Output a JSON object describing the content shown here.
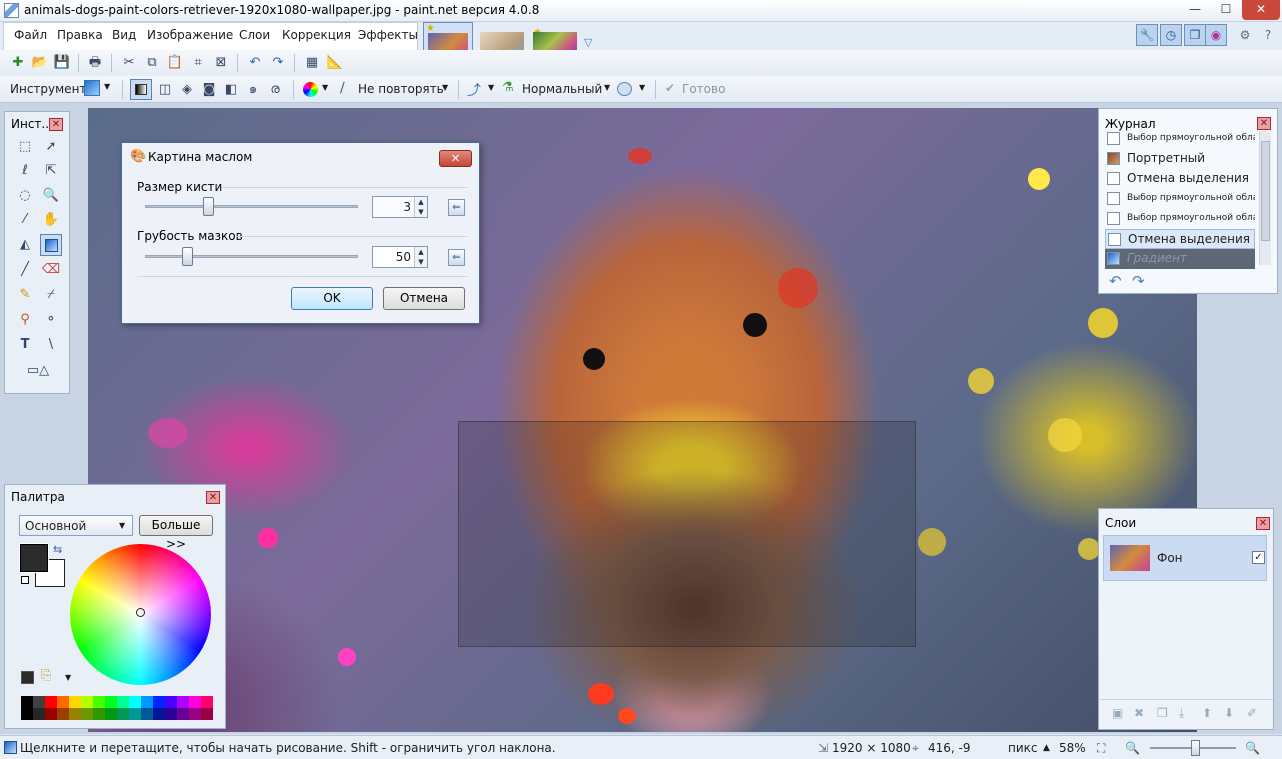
{
  "window": {
    "title": "animals-dogs-paint-colors-retriever-1920x1080-wallpaper.jpg - paint.net версия 4.0.8",
    "minimize": "—",
    "maximize": "☐",
    "close": "✕"
  },
  "menu": {
    "items": [
      "Файл",
      "Правка",
      "Вид",
      "Изображение",
      "Слои",
      "Коррекция",
      "Эффекты"
    ]
  },
  "toolbar2": {
    "tool_label": "Инструмент:",
    "repeat_mode": "Не повторять",
    "blend_mode": "Нормальный",
    "done_label": "Готово"
  },
  "tools_panel": {
    "title": "Инст...",
    "icons": [
      "rect-select-icon",
      "move-selection-icon",
      "lasso-icon",
      "move-selected-icon",
      "ellipse-select-icon",
      "zoom-icon",
      "magic-wand-icon",
      "pan-icon",
      "paint-bucket-icon",
      "gradient-icon",
      "paintbrush-icon",
      "eraser-icon",
      "pencil-icon",
      "color-picker-icon",
      "clone-stamp-icon",
      "recolor-icon",
      "text-icon",
      "line-curve-icon",
      "shapes-icon"
    ]
  },
  "dialog": {
    "title": "Картина маслом",
    "brush_size_label": "Размер кисти",
    "brush_size_value": "3",
    "brush_size_level": 0.3,
    "roughness_label": "Грубость мазков",
    "roughness_value": "50",
    "roughness_level": 0.2,
    "ok": "OK",
    "cancel": "Отмена"
  },
  "palette": {
    "title": "Палитра",
    "mode": "Основной",
    "more": "Больше >>",
    "primary_color": "#2b2b2b",
    "secondary_color": "#ffffff",
    "swatches": [
      "#000000",
      "#404040",
      "#ff0000",
      "#ff6a00",
      "#ffd800",
      "#b6ff00",
      "#4cff00",
      "#00ff21",
      "#00ff90",
      "#00ffff",
      "#0094ff",
      "#0026ff",
      "#4800ff",
      "#b200ff",
      "#ff00dc",
      "#ff006e"
    ]
  },
  "history": {
    "title": "Журнал",
    "items": [
      {
        "label": "Выбор прямоугольной области",
        "small": true
      },
      {
        "label": "Портретный",
        "small": false
      },
      {
        "label": "Отмена выделения",
        "small": false
      },
      {
        "label": "Выбор прямоугольной области",
        "small": true
      },
      {
        "label": "Выбор прямоугольной области",
        "small": true
      },
      {
        "label": "Отмена выделения",
        "small": false
      },
      {
        "label": "Градиент",
        "small": false
      }
    ]
  },
  "layers": {
    "title": "Слои",
    "items": [
      {
        "name": "Фон",
        "visible": true
      }
    ]
  },
  "status": {
    "hint": "Щелкните и перетащите, чтобы начать рисование. Shift - ограничить угол наклона.",
    "image_size": "1920 × 1080",
    "cursor": "416, -9",
    "units": "пикс",
    "zoom": "58%",
    "zoom_level": 0.58
  }
}
